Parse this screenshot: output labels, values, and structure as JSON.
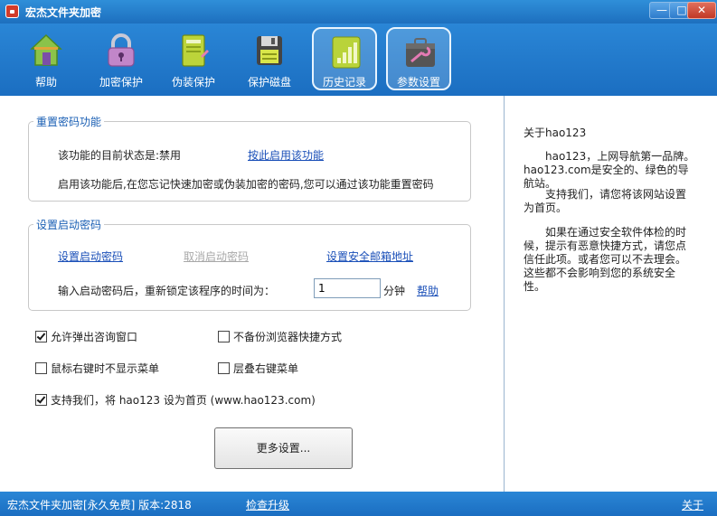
{
  "window": {
    "title": "宏杰文件夹加密",
    "min": "—",
    "max": "□",
    "close": "✕"
  },
  "toolbar": {
    "items": [
      {
        "label": "帮助",
        "icon": "house-icon"
      },
      {
        "label": "加密保护",
        "icon": "padlock-icon"
      },
      {
        "label": "伪装保护",
        "icon": "notebook-icon"
      },
      {
        "label": "保护磁盘",
        "icon": "floppy-disk-icon"
      },
      {
        "label": "历史记录",
        "icon": "history-chart-icon"
      },
      {
        "label": "参数设置",
        "icon": "toolbox-icon"
      }
    ]
  },
  "reset_password": {
    "title": "重置密码功能",
    "status_text": "该功能的目前状态是:禁用",
    "enable_link": "按此启用该功能",
    "description": "启用该功能后,在您忘记快速加密或伪装加密的密码,您可以通过该功能重置密码"
  },
  "startup_password": {
    "title": "设置启动密码",
    "set_link": "设置启动密码",
    "cancel_link": "取消启动密码",
    "email_link": "设置安全邮箱地址",
    "relock_label": "输入启动密码后，重新锁定该程序的时间为：",
    "relock_value": "1",
    "unit": "分钟",
    "help_link": "帮助"
  },
  "options": {
    "allow_popup": {
      "label": "允许弹出咨询窗口",
      "checked": true
    },
    "no_browser_backup": {
      "label": "不备份浏览器快捷方式",
      "checked": false
    },
    "hide_context_menu": {
      "label": "鼠标右键时不显示菜单",
      "checked": false
    },
    "cascade_menu": {
      "label": "层叠右键菜单",
      "checked": false
    },
    "support_homepage": {
      "label": "支持我们，将 hao123 设为首页 (www.hao123.com)",
      "checked": true
    }
  },
  "more_settings": "更多设置...",
  "about": {
    "title": "关于hao123",
    "p1": "hao123，上网导航第一品牌。hao123.com是安全的、绿色的导航站。",
    "p2": "支持我们，请您将该网站设置为首页。",
    "p3": "如果在通过安全软件体检的时候，提示有恶意快捷方式，请您点信任此项。或者您可以不去理会。这些都不会影响到您的系统安全性。"
  },
  "status": {
    "version": "宏杰文件夹加密[永久免费]  版本:2818",
    "check_update": "检查升级",
    "about": "关于"
  }
}
